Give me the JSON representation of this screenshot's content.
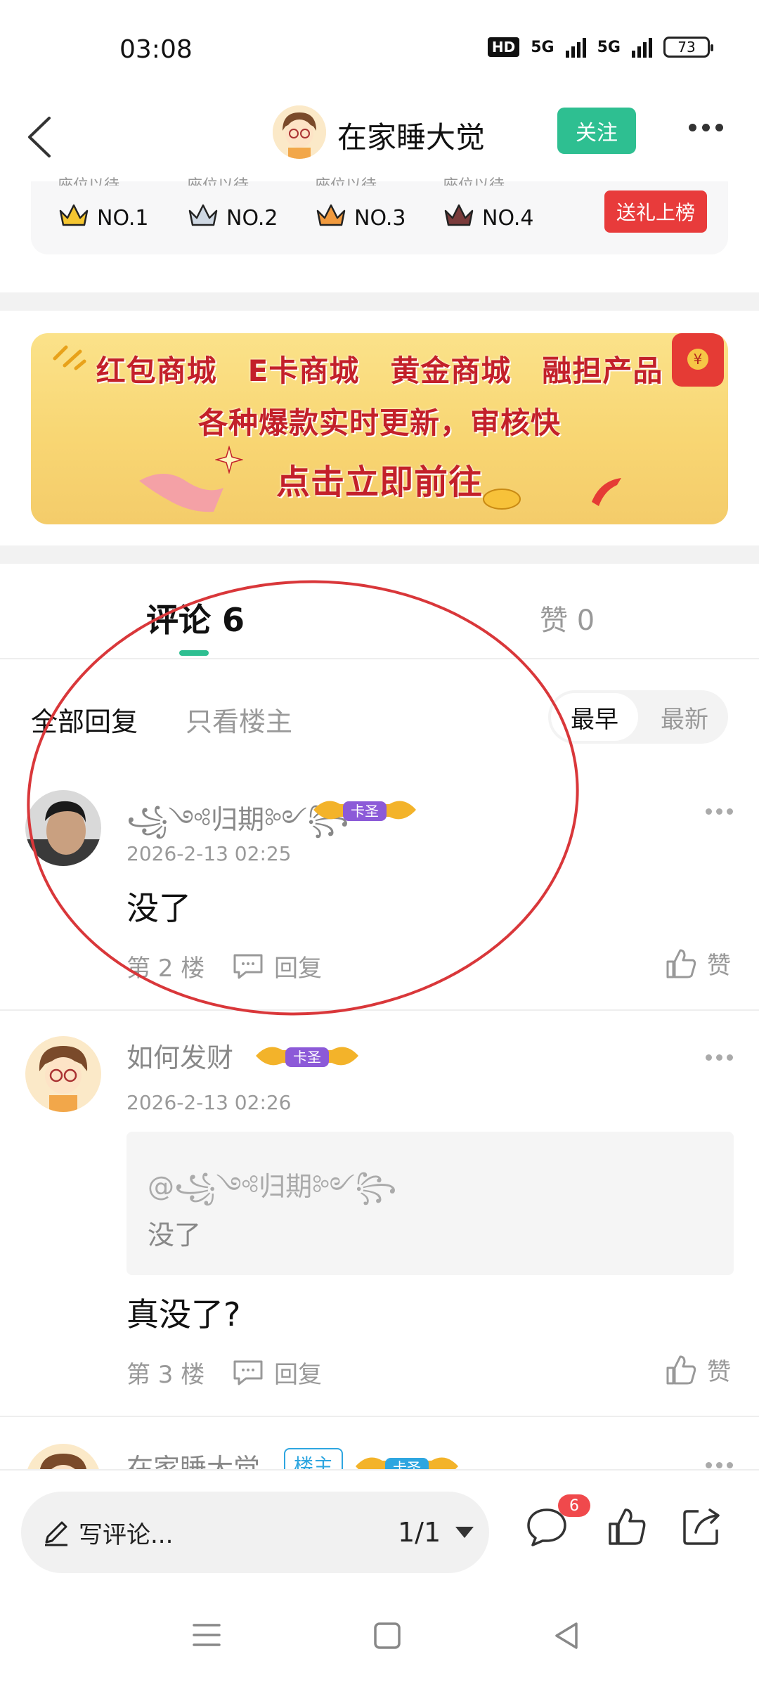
{
  "status_bar": {
    "time": "03:08",
    "hd": "HD",
    "net1": "5G",
    "net2": "5G",
    "battery": "73"
  },
  "header": {
    "title": "在家睡大觉",
    "follow_label": "关注"
  },
  "rank": {
    "ghost_label": "座位以待",
    "items": [
      "NO.1",
      "NO.2",
      "NO.3",
      "NO.4"
    ],
    "gift_label": "送礼上榜"
  },
  "banner": {
    "items": [
      "红包商城",
      "E卡商城",
      "黄金商城",
      "融担产品"
    ],
    "line2": "各种爆款实时更新，审核快",
    "cta": "点击立即前往"
  },
  "tabs": {
    "comment": "评论 6",
    "like": "赞 0"
  },
  "filter": {
    "all": "全部回复",
    "owner_only": "只看楼主",
    "sort_early": "最早",
    "sort_new": "最新"
  },
  "comments": [
    {
      "name": "꧁༺归期༻꧂",
      "badge": "卡圣",
      "time": "2026-2-13 02:25",
      "text": "没了",
      "floor": "第 2 楼",
      "reply": "回复",
      "like": "赞"
    },
    {
      "name": "如何发财",
      "badge": "卡圣",
      "time": "2026-2-13 02:26",
      "quote_user": "@꧁༺归期༻꧂",
      "quote_text": "没了",
      "text": "真没了?",
      "floor": "第 3 楼",
      "reply": "回复",
      "like": "赞"
    },
    {
      "name": "在家睡大觉",
      "owner_tag": "楼主",
      "badge": "卡圣"
    }
  ],
  "bottom_bar": {
    "placeholder": "写评论...",
    "page": "1/1",
    "comment_count": "6"
  },
  "colors": {
    "accent": "#2ebf91",
    "red": "#e83b3b",
    "annotation": "#d9373a"
  },
  "icons": [
    "back-icon",
    "more-icon",
    "crown-icon",
    "comment-icon",
    "thumb-up-icon",
    "share-icon",
    "pen-icon",
    "menu-icon",
    "home-icon",
    "back-triangle-icon"
  ]
}
